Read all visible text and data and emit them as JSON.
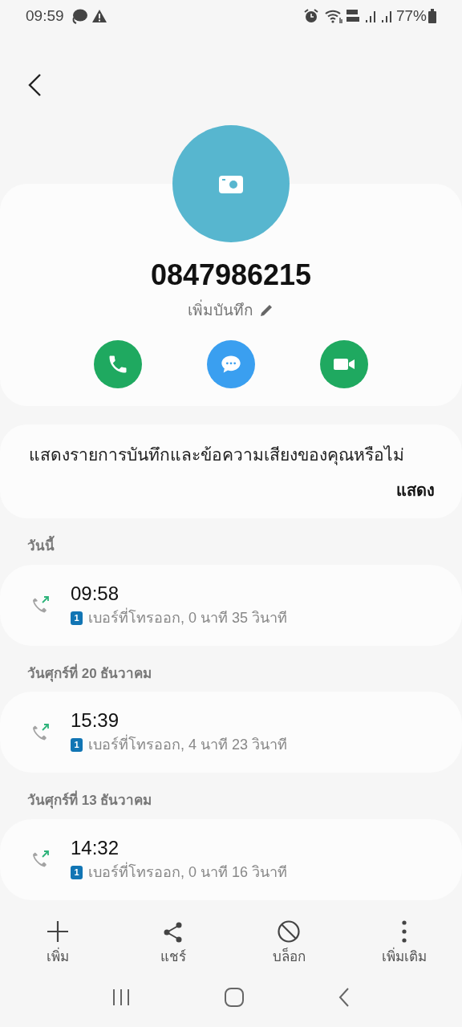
{
  "status_bar": {
    "time": "09:59",
    "battery": "77%"
  },
  "contact": {
    "number": "0847986215",
    "note_link": "เพิ่มบันทึก"
  },
  "actions": [
    {
      "kind": "call"
    },
    {
      "kind": "message"
    },
    {
      "kind": "video"
    }
  ],
  "recording_prompt": {
    "text": "แสดงรายการบันทึกและข้อความเสียงของคุณหรือไม่",
    "button": "แสดง"
  },
  "call_groups": [
    {
      "date": "วันนี้",
      "calls": [
        {
          "time": "09:58",
          "sim": "1",
          "detail": "เบอร์ที่โทรออก, 0 นาที 35 วินาที"
        }
      ]
    },
    {
      "date": "วันศุกร์ที่ 20 ธันวาคม",
      "calls": [
        {
          "time": "15:39",
          "sim": "1",
          "detail": "เบอร์ที่โทรออก, 4 นาที 23 วินาที"
        }
      ]
    },
    {
      "date": "วันศุกร์ที่ 13 ธันวาคม",
      "calls": [
        {
          "time": "14:32",
          "sim": "1",
          "detail": "เบอร์ที่โทรออก, 0 นาที 16 วินาที"
        }
      ]
    }
  ],
  "bottom_actions": [
    {
      "kind": "add",
      "label": "เพิ่ม"
    },
    {
      "kind": "share",
      "label": "แชร์"
    },
    {
      "kind": "block",
      "label": "บล็อก"
    },
    {
      "kind": "more",
      "label": "เพิ่มเติม"
    }
  ]
}
